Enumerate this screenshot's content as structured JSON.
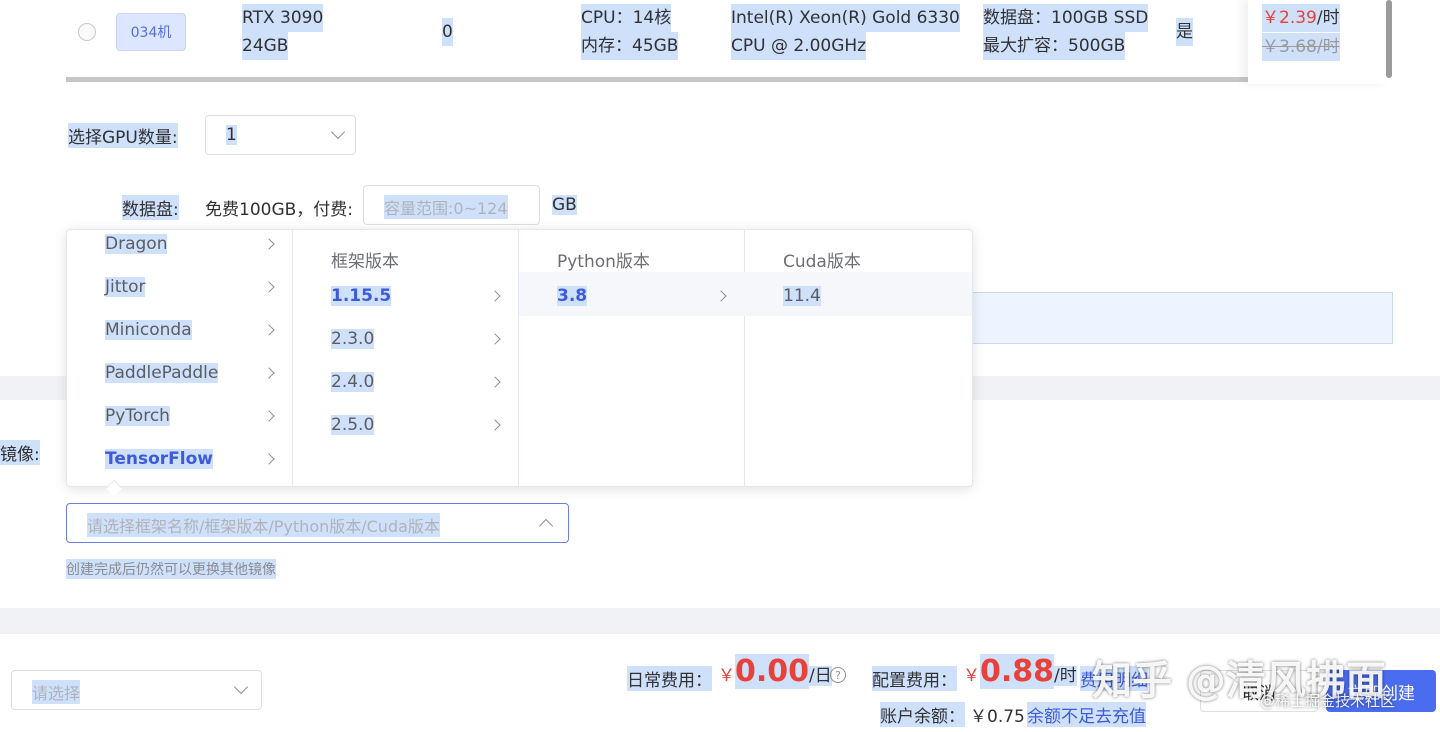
{
  "instance_row": {
    "machine_tag": "034机",
    "gpu_line1": "RTX 3090",
    "gpu_line2": "24GB",
    "idle_gpus": "0",
    "cpu_line1": "CPU：14核",
    "cpu_line2": "内存：45GB",
    "cpu_model_line1": "Intel(R) Xeon(R) Gold 6330",
    "cpu_model_line2": "CPU @ 2.00GHz",
    "disk_line1": "数据盘：100GB SSD",
    "disk_line2": "最大扩容：500GB",
    "expandable": "是",
    "price_current": "￥2.39",
    "price_current_unit": "/时",
    "price_original": "￥3.68/时"
  },
  "gpu_count": {
    "label": "选择GPU数量:",
    "value": "1"
  },
  "data_disk": {
    "label": "数据盘:",
    "free_text": "免费100GB，付费:",
    "placeholder": "容量范围:0~124",
    "unit": "GB"
  },
  "image": {
    "label": "镜像:",
    "placeholder": "请选择框架名称/框架版本/Python版本/Cuda版本",
    "hint": "创建完成后仍然可以更换其他镜像"
  },
  "cascader": {
    "frameworks": [
      "Dragon",
      "Jittor",
      "Miniconda",
      "PaddlePaddle",
      "PyTorch",
      "TensorFlow"
    ],
    "framework_versions_header": "框架版本",
    "framework_versions": [
      "1.15.5",
      "2.3.0",
      "2.4.0",
      "2.5.0"
    ],
    "python_header": "Python版本",
    "python_versions": [
      "3.8"
    ],
    "cuda_header": "Cuda版本",
    "cuda_versions": [
      "11.4"
    ]
  },
  "footer": {
    "select_placeholder": "请选择",
    "daily_label": "日常费用：",
    "daily_currency": "￥",
    "daily_value": "0.00",
    "daily_unit": "/日",
    "help_glyph": "?",
    "config_label": "配置费用：",
    "config_currency": "￥",
    "config_value": "0.88",
    "config_unit": "/时",
    "fee_detail_link": "费用明细",
    "balance_label": "账户余额：",
    "balance_value": "￥0.75",
    "recharge_link": "余额不足去充值",
    "cancel_button": "取消",
    "create_button": "立即创建"
  },
  "watermark": {
    "main": "知乎 @清风拂面",
    "sub": "@稀土掘金技术社区"
  },
  "colors": {
    "accent": "#3d5bd9",
    "price_red": "#e8413a",
    "highlight": "#cfe0fb"
  }
}
